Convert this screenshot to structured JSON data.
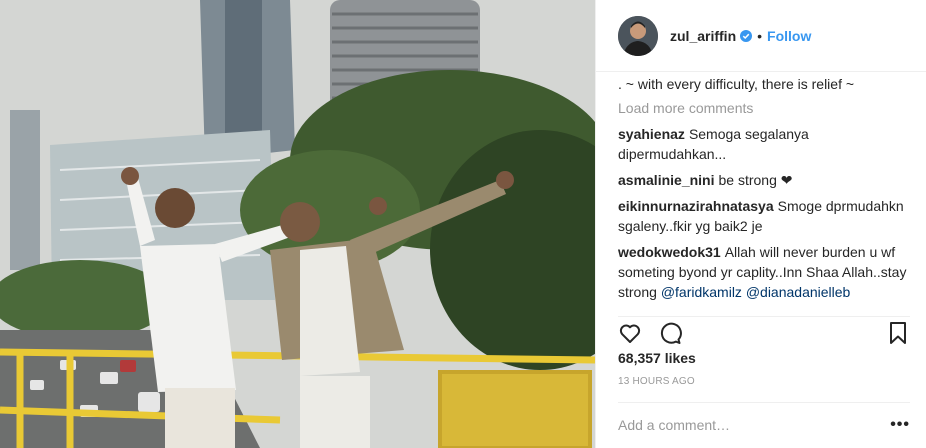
{
  "post": {
    "username": "zul_ariffin",
    "separator": "•",
    "follow_label": "Follow",
    "caption_tail": ". ~ with every difficulty, there is relief ~",
    "load_more_label": "Load more comments",
    "comments": [
      {
        "user": "syahienaz",
        "text": "Semoga segalanya dipermudahkan..."
      },
      {
        "user": "asmalinie_nini",
        "text": "be strong ❤"
      },
      {
        "user": "eikinnurnazirahnatasya",
        "text": "Smoge dprmudahkn sgaleny..fkir yg baik2 je"
      },
      {
        "user": "wedokwedok31",
        "text": "Allah will never burden u wf someting byond yr caplity..Inn Shaa Allah..stay strong",
        "mentions": [
          "@faridkamilz",
          "@dianadanielleb"
        ]
      }
    ],
    "likes": "68,357 likes",
    "time": "13 HOURS AGO",
    "add_comment_placeholder": "Add a comment…",
    "more_label": "•••",
    "icons": {
      "like": "heart-icon",
      "comment": "comment-icon",
      "save": "bookmark-icon",
      "verified": "verified-badge-icon",
      "more": "more-options-icon"
    },
    "colors": {
      "follow": "#3897f0",
      "mention": "#003569",
      "muted": "#999999",
      "verified": "#3897f0"
    }
  }
}
